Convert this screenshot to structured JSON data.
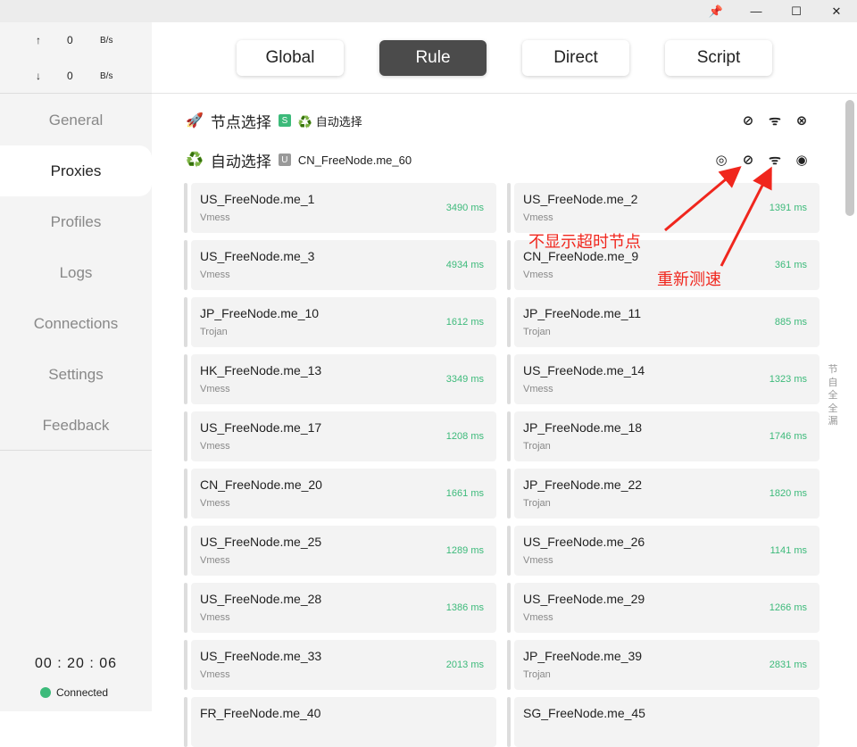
{
  "titlebar": {
    "pin": "📌",
    "minimize": "—",
    "maximize": "☐",
    "close": "✕"
  },
  "traffic": {
    "up_arrow": "↑",
    "up_value": "0",
    "up_unit": "B/s",
    "down_arrow": "↓",
    "down_value": "0",
    "down_unit": "B/s"
  },
  "nav": [
    "General",
    "Proxies",
    "Profiles",
    "Logs",
    "Connections",
    "Settings",
    "Feedback"
  ],
  "timer": "00 : 20 : 06",
  "status": "Connected",
  "modes": [
    "Global",
    "Rule",
    "Direct",
    "Script"
  ],
  "groups": [
    {
      "emoji": "🚀",
      "name": "节点选择",
      "badge": "S",
      "badge_color": "#3cba7a",
      "now": "♻️ 自动选择"
    },
    {
      "emoji": "♻️",
      "name": "自动选择",
      "badge": "U",
      "badge_color": "#999999",
      "now": "CN_FreeNode.me_60"
    }
  ],
  "proxies": [
    {
      "name": "US_FreeNode.me_1",
      "type": "Vmess",
      "delay": "3490 ms"
    },
    {
      "name": "US_FreeNode.me_2",
      "type": "Vmess",
      "delay": "1391 ms"
    },
    {
      "name": "US_FreeNode.me_3",
      "type": "Vmess",
      "delay": "4934 ms"
    },
    {
      "name": "CN_FreeNode.me_9",
      "type": "Vmess",
      "delay": "361 ms"
    },
    {
      "name": "JP_FreeNode.me_10",
      "type": "Trojan",
      "delay": "1612 ms"
    },
    {
      "name": "JP_FreeNode.me_11",
      "type": "Trojan",
      "delay": "885 ms"
    },
    {
      "name": "HK_FreeNode.me_13",
      "type": "Vmess",
      "delay": "3349 ms"
    },
    {
      "name": "US_FreeNode.me_14",
      "type": "Vmess",
      "delay": "1323 ms"
    },
    {
      "name": "US_FreeNode.me_17",
      "type": "Vmess",
      "delay": "1208 ms"
    },
    {
      "name": "JP_FreeNode.me_18",
      "type": "Trojan",
      "delay": "1746 ms"
    },
    {
      "name": "CN_FreeNode.me_20",
      "type": "Vmess",
      "delay": "1661 ms"
    },
    {
      "name": "JP_FreeNode.me_22",
      "type": "Trojan",
      "delay": "1820 ms"
    },
    {
      "name": "US_FreeNode.me_25",
      "type": "Vmess",
      "delay": "1289 ms"
    },
    {
      "name": "US_FreeNode.me_26",
      "type": "Vmess",
      "delay": "1141 ms"
    },
    {
      "name": "US_FreeNode.me_28",
      "type": "Vmess",
      "delay": "1386 ms"
    },
    {
      "name": "US_FreeNode.me_29",
      "type": "Vmess",
      "delay": "1266 ms"
    },
    {
      "name": "US_FreeNode.me_33",
      "type": "Vmess",
      "delay": "2013 ms"
    },
    {
      "name": "JP_FreeNode.me_39",
      "type": "Trojan",
      "delay": "2831 ms"
    },
    {
      "name": "FR_FreeNode.me_40",
      "type": "",
      "delay": ""
    },
    {
      "name": "SG_FreeNode.me_45",
      "type": "",
      "delay": ""
    }
  ],
  "side_letters": [
    "节",
    "自",
    "全",
    "全",
    "漏"
  ],
  "annotations": {
    "hide_timeout": "不显示超时节点",
    "retest": "重新测速"
  }
}
